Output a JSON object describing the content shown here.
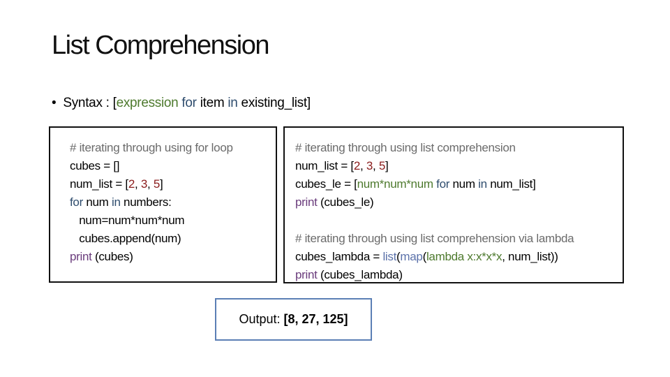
{
  "title": "List Comprehension",
  "bullet": {
    "prefix": "Syntax : [",
    "expression": "expression",
    "kw_for": " for ",
    "item": "item",
    "kw_in": " in ",
    "rest": "existing_list]"
  },
  "colors": {
    "comment": "#6b6b6b",
    "number": "#8b1c1c",
    "keyword": "#2f4d6e",
    "builtin": "#6a3c7c",
    "expr": "#4e7a2e",
    "func": "#5c72aa",
    "text": "#000000",
    "output_border": "#5b7fb5"
  },
  "left_code": [
    [
      [
        "# iterating through using for loop",
        "comment"
      ]
    ],
    [
      [
        "cubes = []",
        "text"
      ]
    ],
    [
      [
        "num_list = [",
        "text"
      ],
      [
        "2",
        "number"
      ],
      [
        ", ",
        "text"
      ],
      [
        "3",
        "number"
      ],
      [
        ", ",
        "text"
      ],
      [
        "5",
        "number"
      ],
      [
        "]",
        "text"
      ]
    ],
    [
      [
        "for",
        "keyword"
      ],
      [
        " num ",
        "text"
      ],
      [
        "in",
        "keyword"
      ],
      [
        " numbers:",
        "text"
      ]
    ],
    [
      [
        "   num=num*num*num",
        "text"
      ]
    ],
    [
      [
        "   cubes.append(num)",
        "text"
      ]
    ],
    [
      [
        "print",
        "builtin"
      ],
      [
        " (cubes)",
        "text"
      ]
    ]
  ],
  "right_code": [
    [
      [
        "# iterating through using list comprehension",
        "comment"
      ]
    ],
    [
      [
        "num_list = [",
        "text"
      ],
      [
        "2",
        "number"
      ],
      [
        ", ",
        "text"
      ],
      [
        "3",
        "number"
      ],
      [
        ", ",
        "text"
      ],
      [
        "5",
        "number"
      ],
      [
        "]",
        "text"
      ]
    ],
    [
      [
        "cubes_le = [",
        "text"
      ],
      [
        "num*num*num ",
        "expr"
      ],
      [
        "for",
        "keyword"
      ],
      [
        " num ",
        "text"
      ],
      [
        "in",
        "keyword"
      ],
      [
        " num_list]",
        "text"
      ]
    ],
    [
      [
        "print",
        "builtin"
      ],
      [
        " (cubes_le)",
        "text"
      ]
    ],
    [
      [
        " ",
        "text"
      ]
    ],
    [
      [
        "# iterating through using list comprehension via lambda",
        "comment"
      ]
    ],
    [
      [
        "cubes_lambda = ",
        "text"
      ],
      [
        "list",
        "func"
      ],
      [
        "(",
        "text"
      ],
      [
        "map",
        "func"
      ],
      [
        "(",
        "text"
      ],
      [
        "lambda x:x*x*x",
        "expr"
      ],
      [
        ", num_list))",
        "text"
      ]
    ],
    [
      [
        "print",
        "builtin"
      ],
      [
        " (cubes_lambda)",
        "text"
      ]
    ]
  ],
  "output": {
    "label": "Output:",
    "value": "[8, 27, 125]"
  }
}
